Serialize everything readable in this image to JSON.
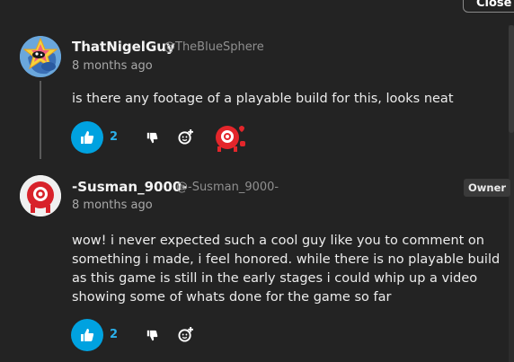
{
  "modal": {
    "close_label": "Close"
  },
  "comments": [
    {
      "username": "ThatNigelGuy",
      "handle": "@TheBlueSphere",
      "time": "8 months ago",
      "text": "is there any footage of a playable build for this, looks neat",
      "likes": "2",
      "avatar_icon": "star-character-avatar",
      "reaction_icon": "red-eye-heart-reaction"
    },
    {
      "username": "-Susman_9000-",
      "handle": "@-Susman_9000-",
      "badge": "Owner",
      "time": "8 months ago",
      "text": "wow! i never expected such a cool guy like you to comment on something i made, i feel honored. while there is no playable build as this game is still in the early stages i could whip up a video showing some of whats done for the game so far",
      "likes": "2",
      "avatar_icon": "red-eye-avatar"
    }
  ],
  "colors": {
    "background": "#232323",
    "accent": "#00a2e0",
    "reaction_red": "#e3262b"
  }
}
